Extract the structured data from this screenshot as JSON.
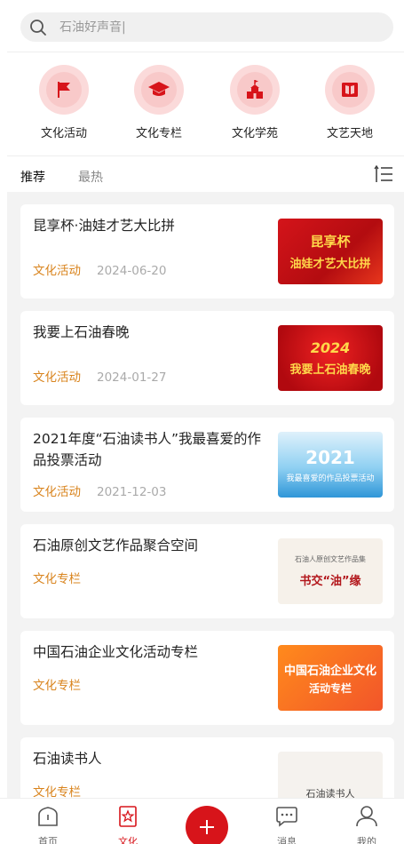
{
  "search": {
    "placeholder": "石油好声音|"
  },
  "categories": [
    {
      "label": "文化活动",
      "icon": "flag-icon"
    },
    {
      "label": "文化专栏",
      "icon": "graduation-cap-icon"
    },
    {
      "label": "文化学苑",
      "icon": "building-icon"
    },
    {
      "label": "文艺天地",
      "icon": "book-icon"
    }
  ],
  "tabs": [
    {
      "label": "推荐",
      "active": true
    },
    {
      "label": "最热",
      "active": false
    }
  ],
  "articles": [
    {
      "title": "昆享杯·油娃才艺大比拼",
      "category": "文化活动",
      "date": "2024-06-20",
      "thumb_text": [
        "昆享杯",
        "油娃才艺大比拼"
      ]
    },
    {
      "title": "我要上石油春晚",
      "category": "文化活动",
      "date": "2024-01-27",
      "thumb_text": [
        "2024",
        "我要上石油春晚"
      ]
    },
    {
      "title": "2021年度“石油读书人”我最喜爱的作品投票活动",
      "category": "文化活动",
      "date": "2021-12-03",
      "thumb_text": [
        "2021",
        "我最喜爱的作品投票活动"
      ]
    },
    {
      "title": "石油原创文艺作品聚合空间",
      "category": "文化专栏",
      "date": "",
      "thumb_text": [
        "石油人原创文艺作品集",
        "书交“油”缘"
      ]
    },
    {
      "title": "中国石油企业文化活动专栏",
      "category": "文化专栏",
      "date": "",
      "thumb_text": [
        "中国石油企业文化",
        "活动专栏"
      ]
    },
    {
      "title": "石油读书人",
      "category": "文化专栏",
      "date": "",
      "thumb_text": [
        "石油读书人"
      ]
    }
  ],
  "nav": [
    {
      "label": "首页",
      "icon": "home-icon"
    },
    {
      "label": "文化",
      "icon": "star-badge-icon"
    },
    {
      "label": "",
      "icon": "plus-icon"
    },
    {
      "label": "消息",
      "icon": "chat-icon"
    },
    {
      "label": "我的",
      "icon": "user-icon"
    }
  ],
  "colors": {
    "accent": "#d7141a",
    "tag": "#d9841e"
  }
}
